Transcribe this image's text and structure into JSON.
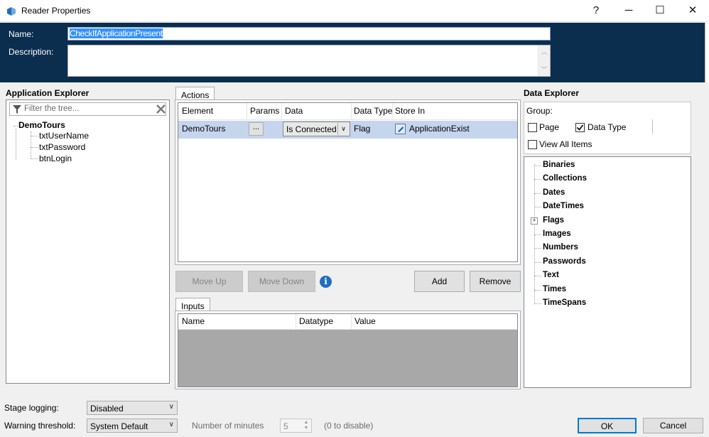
{
  "window": {
    "title": "Reader Properties",
    "help_label": "?",
    "minimize_label": "─",
    "maximize_label": "☐",
    "close_label": "✕"
  },
  "header": {
    "name_label": "Name:",
    "name_value": "CheckIfApplicationPresent",
    "description_label": "Description:",
    "description_value": ""
  },
  "app_explorer": {
    "title": "Application Explorer",
    "filter_placeholder": "Filter the tree...",
    "root": "DemoTours",
    "children": [
      "txtUserName",
      "txtPassword",
      "btnLogin"
    ]
  },
  "actions": {
    "tab": "Actions",
    "columns": [
      "Element",
      "Params",
      "Data",
      "Data Type",
      "Store In"
    ],
    "rows": [
      {
        "element": "DemoTours",
        "params": "...",
        "data": "Is Connected",
        "data_type": "Flag",
        "store_in": "ApplicationExist"
      }
    ],
    "buttons": {
      "move_up": "Move Up",
      "move_down": "Move Down",
      "add": "Add",
      "remove": "Remove",
      "info_icon": "i"
    }
  },
  "inputs": {
    "tab": "Inputs",
    "columns": [
      "Name",
      "Datatype",
      "Value"
    ]
  },
  "data_explorer": {
    "title": "Data Explorer",
    "group_label": "Group:",
    "page_label": "Page",
    "page_checked": false,
    "data_type_label": "Data Type",
    "data_type_checked": true,
    "view_all_label": "View All Items",
    "view_all_checked": false,
    "items": [
      "Binaries",
      "Collections",
      "Dates",
      "DateTimes",
      "Flags",
      "Images",
      "Numbers",
      "Passwords",
      "Text",
      "Times",
      "TimeSpans"
    ],
    "expand_glyph": "+"
  },
  "footer": {
    "stage_logging_label": "Stage logging:",
    "stage_logging_value": "Disabled",
    "warning_label": "Warning threshold:",
    "warning_value": "System Default",
    "minutes_label": "Number of minutes",
    "minutes_value": "5",
    "minutes_hint": "(0 to disable)",
    "ok_label": "OK",
    "cancel_label": "Cancel"
  },
  "colors": {
    "header_bg": "#0b2e4f",
    "selection": "#3390ff",
    "row_highlight": "#c5d5ee",
    "info_blue": "#1f6fc0"
  }
}
